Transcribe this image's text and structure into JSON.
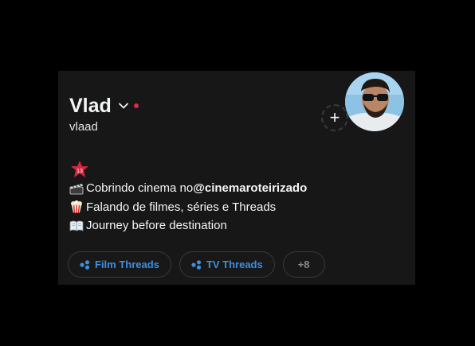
{
  "profile": {
    "display_name": "Vlad",
    "username": "vlaad",
    "status_color": "#e2264d",
    "badge_number": "13"
  },
  "add_story": {
    "symbol": "+"
  },
  "bio": {
    "line1_text": "Cobrindo cinema no ",
    "line1_handle": "@cinemaroteirizado",
    "line2_text": "Falando de filmes, séries e Threads",
    "line3_text": "Journey before destination"
  },
  "chips": {
    "items": [
      {
        "label": "Film Threads",
        "icon": "tag-icon"
      },
      {
        "label": "TV Threads",
        "icon": "tag-icon"
      }
    ],
    "more_label": "+8"
  },
  "colors": {
    "background": "#000000",
    "card": "#171717",
    "accent": "#3d8fe0"
  }
}
